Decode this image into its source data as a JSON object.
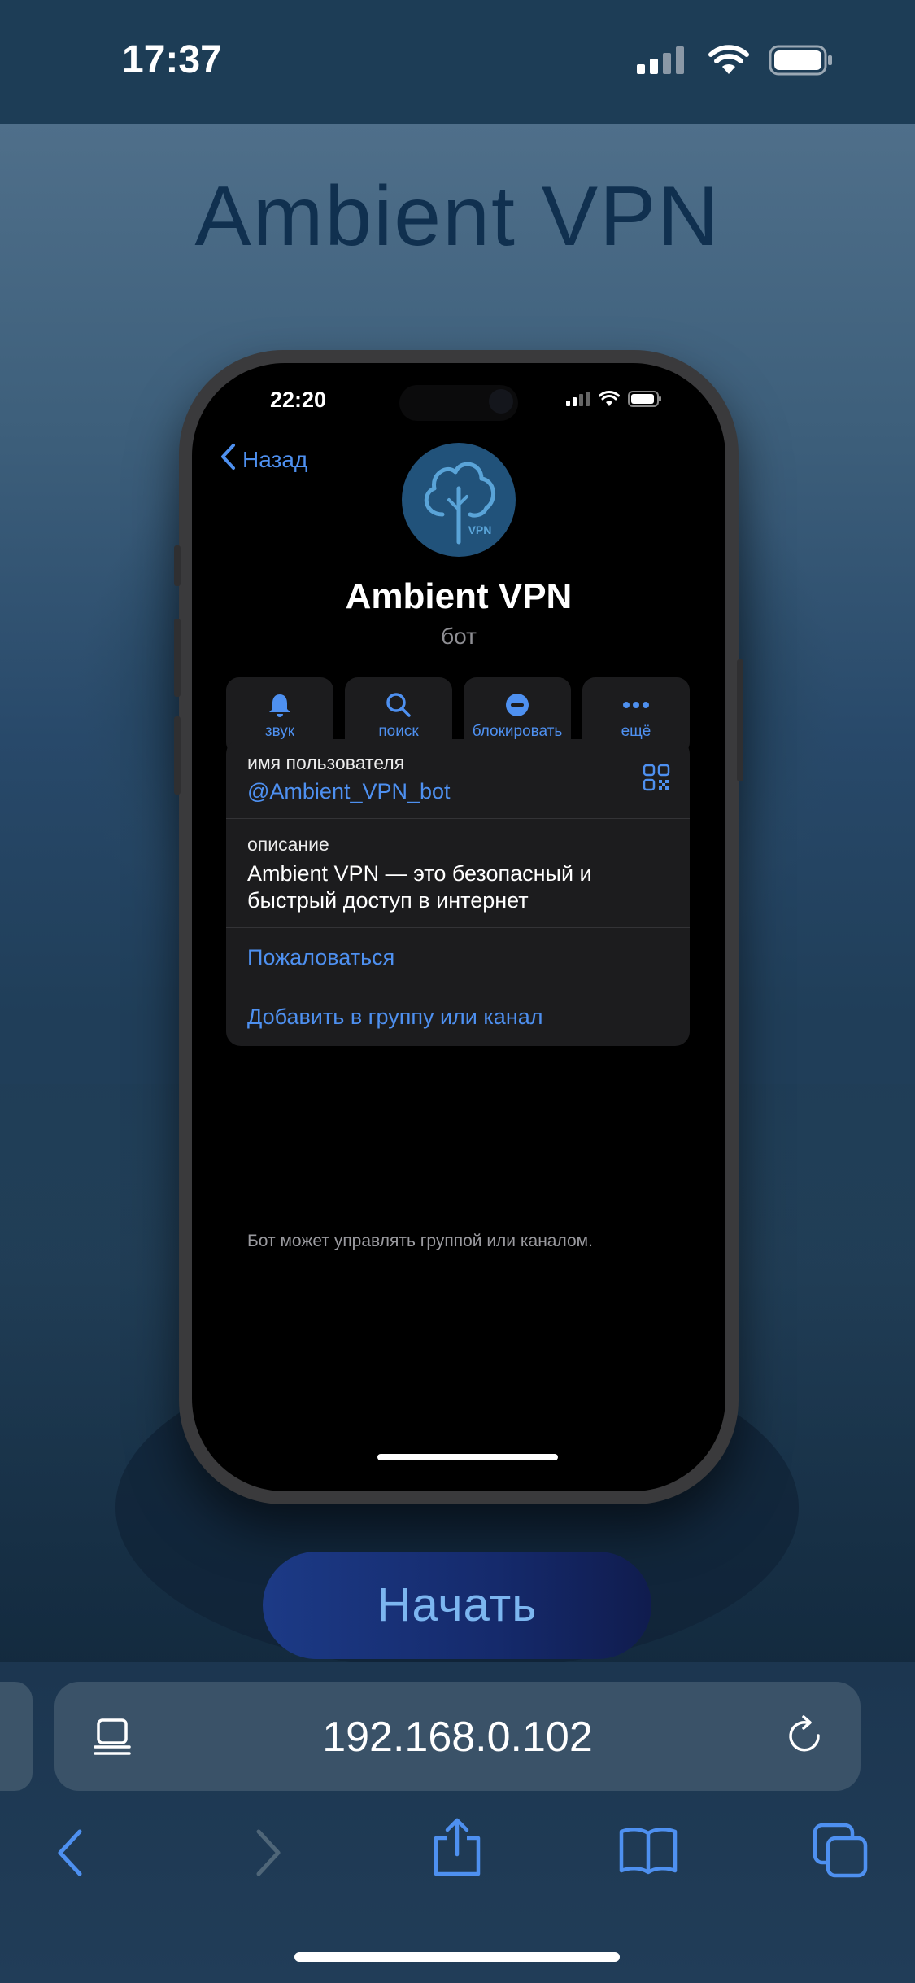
{
  "status_bar": {
    "time": "17:37"
  },
  "page": {
    "title": "Ambient VPN",
    "start_button": "Начать"
  },
  "phone": {
    "time": "22:20",
    "back_label": "Назад",
    "bot_name": "Ambient VPN",
    "bot_subtitle": "бот",
    "avatar_badge": "VPN",
    "actions": [
      {
        "label": "звук",
        "icon": "bell-icon"
      },
      {
        "label": "поиск",
        "icon": "search-icon"
      },
      {
        "label": "блокировать",
        "icon": "block-icon"
      },
      {
        "label": "ещё",
        "icon": "more-icon"
      }
    ],
    "username_label": "имя пользователя",
    "username_value": "@Ambient_VPN_bot",
    "description_label": "описание",
    "description_text": "Ambient VPN — это безопасный и быстрый доступ в интернет",
    "report_link": "Пожаловаться",
    "add_link": "Добавить в группу или канал",
    "hint": "Бот может управлять группой или каналом."
  },
  "browser": {
    "url": "192.168.0.102"
  },
  "colors": {
    "accent": "#4e90f0",
    "start_button_text": "#7cb6f0",
    "title": "#10304f"
  }
}
